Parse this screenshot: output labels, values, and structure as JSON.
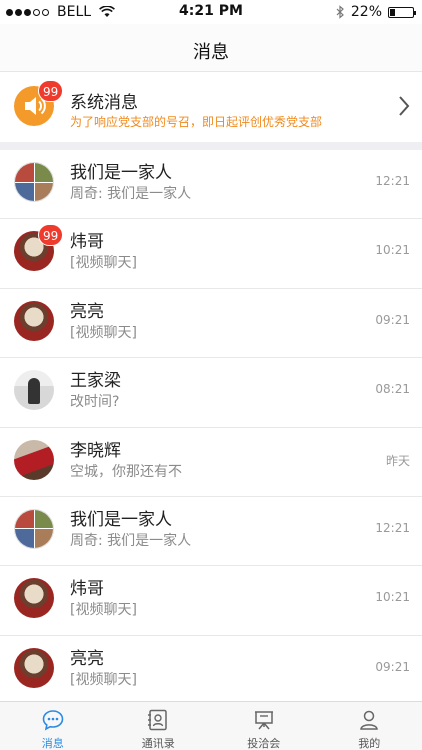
{
  "status_bar": {
    "carrier": "BELL",
    "time": "4:21 PM",
    "battery": "22%",
    "battery_level": 0.22
  },
  "nav": {
    "title": "消息"
  },
  "system_message": {
    "title": "系统消息",
    "subtitle": "为了响应党支部的号召，即日起评创优秀党支部...",
    "badge": "99",
    "icon": "speaker-icon"
  },
  "conversations": [
    {
      "name": "我们是一家人",
      "preview": "周奇: 我们是一家人",
      "time": "12:21",
      "badge": "",
      "avatar": "group-avatar"
    },
    {
      "name": "炜哥",
      "preview": "[视频聊天]",
      "time": "10:21",
      "badge": "99",
      "avatar": "bear-avatar"
    },
    {
      "name": "亮亮",
      "preview": "[视频聊天]",
      "time": "09:21",
      "badge": "",
      "avatar": "bear-avatar"
    },
    {
      "name": "王家梁",
      "preview": "改时间?",
      "time": "08:21",
      "badge": "",
      "avatar": "person-avatar"
    },
    {
      "name": "李晓辉",
      "preview": "空城，你那还有不",
      "time": "昨天",
      "badge": "",
      "avatar": "car-avatar"
    },
    {
      "name": "我们是一家人",
      "preview": "周奇: 我们是一家人",
      "time": "12:21",
      "badge": "",
      "avatar": "group-avatar"
    },
    {
      "name": "炜哥",
      "preview": "[视频聊天]",
      "time": "10:21",
      "badge": "",
      "avatar": "bear-avatar"
    },
    {
      "name": "亮亮",
      "preview": "[视频聊天]",
      "time": "09:21",
      "badge": "",
      "avatar": "bear-avatar"
    }
  ],
  "tabs": [
    {
      "label": "消息",
      "icon": "chat-bubble-icon",
      "active": true
    },
    {
      "label": "通讯录",
      "icon": "contacts-icon",
      "active": false
    },
    {
      "label": "投洽会",
      "icon": "presentation-board-icon",
      "active": false
    },
    {
      "label": "我的",
      "icon": "person-icon",
      "active": false
    }
  ],
  "colors": {
    "accent": "#2b8be3",
    "badge": "#ee3b2e",
    "system_icon": "#f39a2b",
    "system_subtitle": "#f08a1c"
  }
}
